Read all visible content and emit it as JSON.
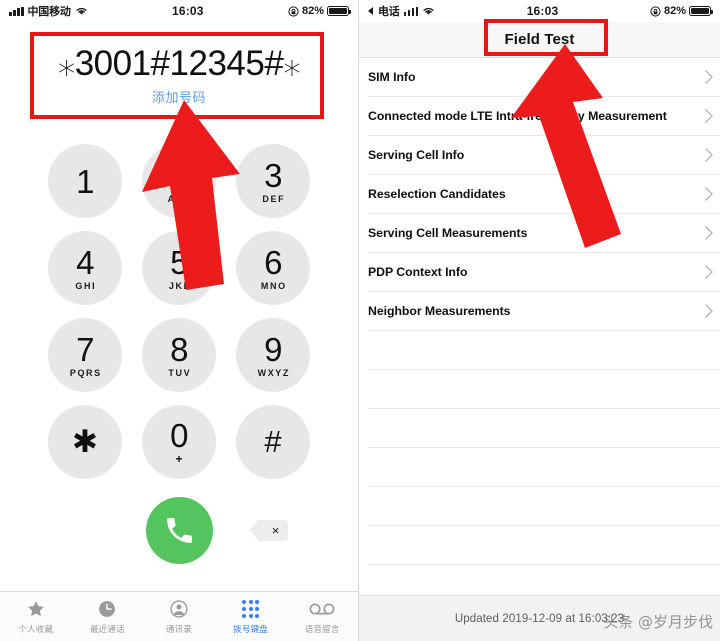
{
  "left_phone": {
    "status_bar": {
      "carrier": "中国移动",
      "time": "16:03",
      "battery_pct": "82%",
      "signal_icon": "signal-bars-icon",
      "wifi_icon": "wifi-icon",
      "lock_icon": "rotation-lock-icon",
      "battery_icon": "battery-icon"
    },
    "dialer": {
      "number": "⁎3001#12345#⁎",
      "add_number_label": "添加号码",
      "add_number_color": "#5c9ddd",
      "keys": [
        {
          "digit": "1",
          "letters": ""
        },
        {
          "digit": "2",
          "letters": "ABC"
        },
        {
          "digit": "3",
          "letters": "DEF"
        },
        {
          "digit": "4",
          "letters": "GHI"
        },
        {
          "digit": "5",
          "letters": "JKL"
        },
        {
          "digit": "6",
          "letters": "MNO"
        },
        {
          "digit": "7",
          "letters": "PQRS"
        },
        {
          "digit": "8",
          "letters": "TUV"
        },
        {
          "digit": "9",
          "letters": "WXYZ"
        },
        {
          "digit": "✱",
          "letters": ""
        },
        {
          "digit": "0",
          "letters": "+"
        },
        {
          "digit": "#",
          "letters": ""
        }
      ],
      "call_button_icon": "phone-call-icon",
      "call_button_color": "#54c45e",
      "delete_button_icon": "backspace-delete-icon",
      "delete_glyph": "×"
    },
    "tab_bar": {
      "items": [
        {
          "label": "个人收藏",
          "icon": "star-icon",
          "active": false
        },
        {
          "label": "最近通话",
          "icon": "clock-recents-icon",
          "active": false
        },
        {
          "label": "通讯录",
          "icon": "person-contacts-icon",
          "active": false
        },
        {
          "label": "拨号键盘",
          "icon": "keypad-dots-icon",
          "active": true
        },
        {
          "label": "语音留言",
          "icon": "voicemail-icon",
          "active": false
        }
      ],
      "active_color": "#3c7ee8",
      "inactive_color": "#9a9a9a"
    }
  },
  "right_phone": {
    "status_bar": {
      "back_label": "电话",
      "back_icon": "back-triangle-icon",
      "time": "16:03",
      "battery_pct": "82%",
      "signal_icon": "signal-bars-icon",
      "wifi_icon": "wifi-icon",
      "lock_icon": "rotation-lock-icon",
      "battery_icon": "battery-icon"
    },
    "nav": {
      "title": "Field Test"
    },
    "list_items": [
      {
        "label": "SIM Info"
      },
      {
        "label": "Connected mode LTE Intra-frequency Measurement"
      },
      {
        "label": "Serving Cell Info"
      },
      {
        "label": "Reselection Candidates"
      },
      {
        "label": "Serving Cell Measurements"
      },
      {
        "label": "PDP Context Info"
      },
      {
        "label": "Neighbor Measurements"
      }
    ],
    "empty_row_count": 7,
    "footer": {
      "updated_text": "Updated 2019-12-09 at 16:03:23",
      "watermark": "头条 @岁月步伐"
    }
  },
  "annotations": {
    "accent_color": "#e81616",
    "left_box": {
      "label": "highlight-box-dial-number"
    },
    "left_arrow": {
      "label": "arrow-pointing-to-dial-number"
    },
    "right_box": {
      "label": "highlight-box-field-test-title"
    },
    "right_arrow": {
      "label": "arrow-pointing-to-field-test-title"
    }
  }
}
